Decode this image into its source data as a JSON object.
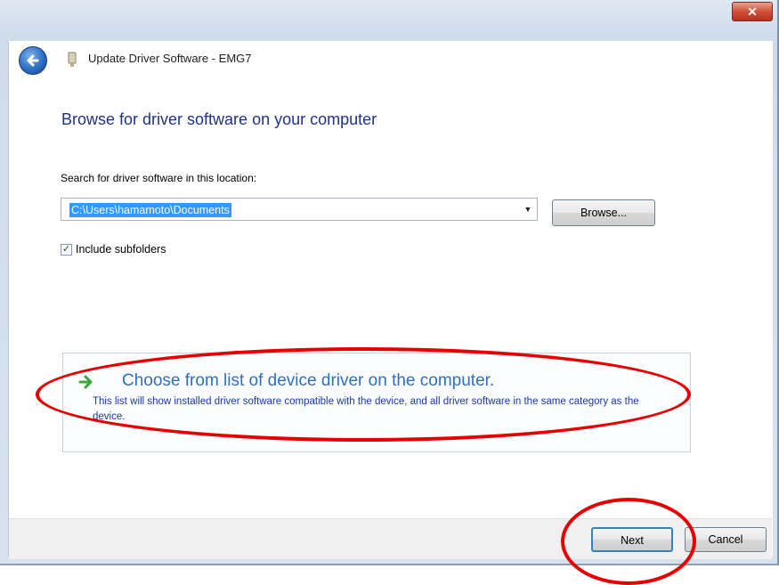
{
  "window": {
    "title": "Update Driver Software - EMG7",
    "close_glyph": "✕"
  },
  "icons": {
    "back": "back-arrow-icon",
    "device": "device-icon",
    "option": "green-arrow-icon"
  },
  "main": {
    "heading": "Browse for driver software on your computer",
    "search_label": "Search for driver software in this location:",
    "path_value": "C:\\Users\\hamamoto\\Documents",
    "browse_label": "Browse...",
    "include_subfolders_label": "Include subfolders",
    "include_subfolders_checked": true,
    "checkmark": "✓"
  },
  "option": {
    "title": "Choose from list of device driver on the computer.",
    "description": "This list will show installed driver software compatible with the device, and all driver software in the same category as the device."
  },
  "footer": {
    "next_label": "Next",
    "cancel_label": "Cancel"
  },
  "colors": {
    "annotation": "#e60000",
    "link_blue": "#2f6fc0",
    "heading_blue": "#1e3287",
    "selection": "#3399ff"
  }
}
